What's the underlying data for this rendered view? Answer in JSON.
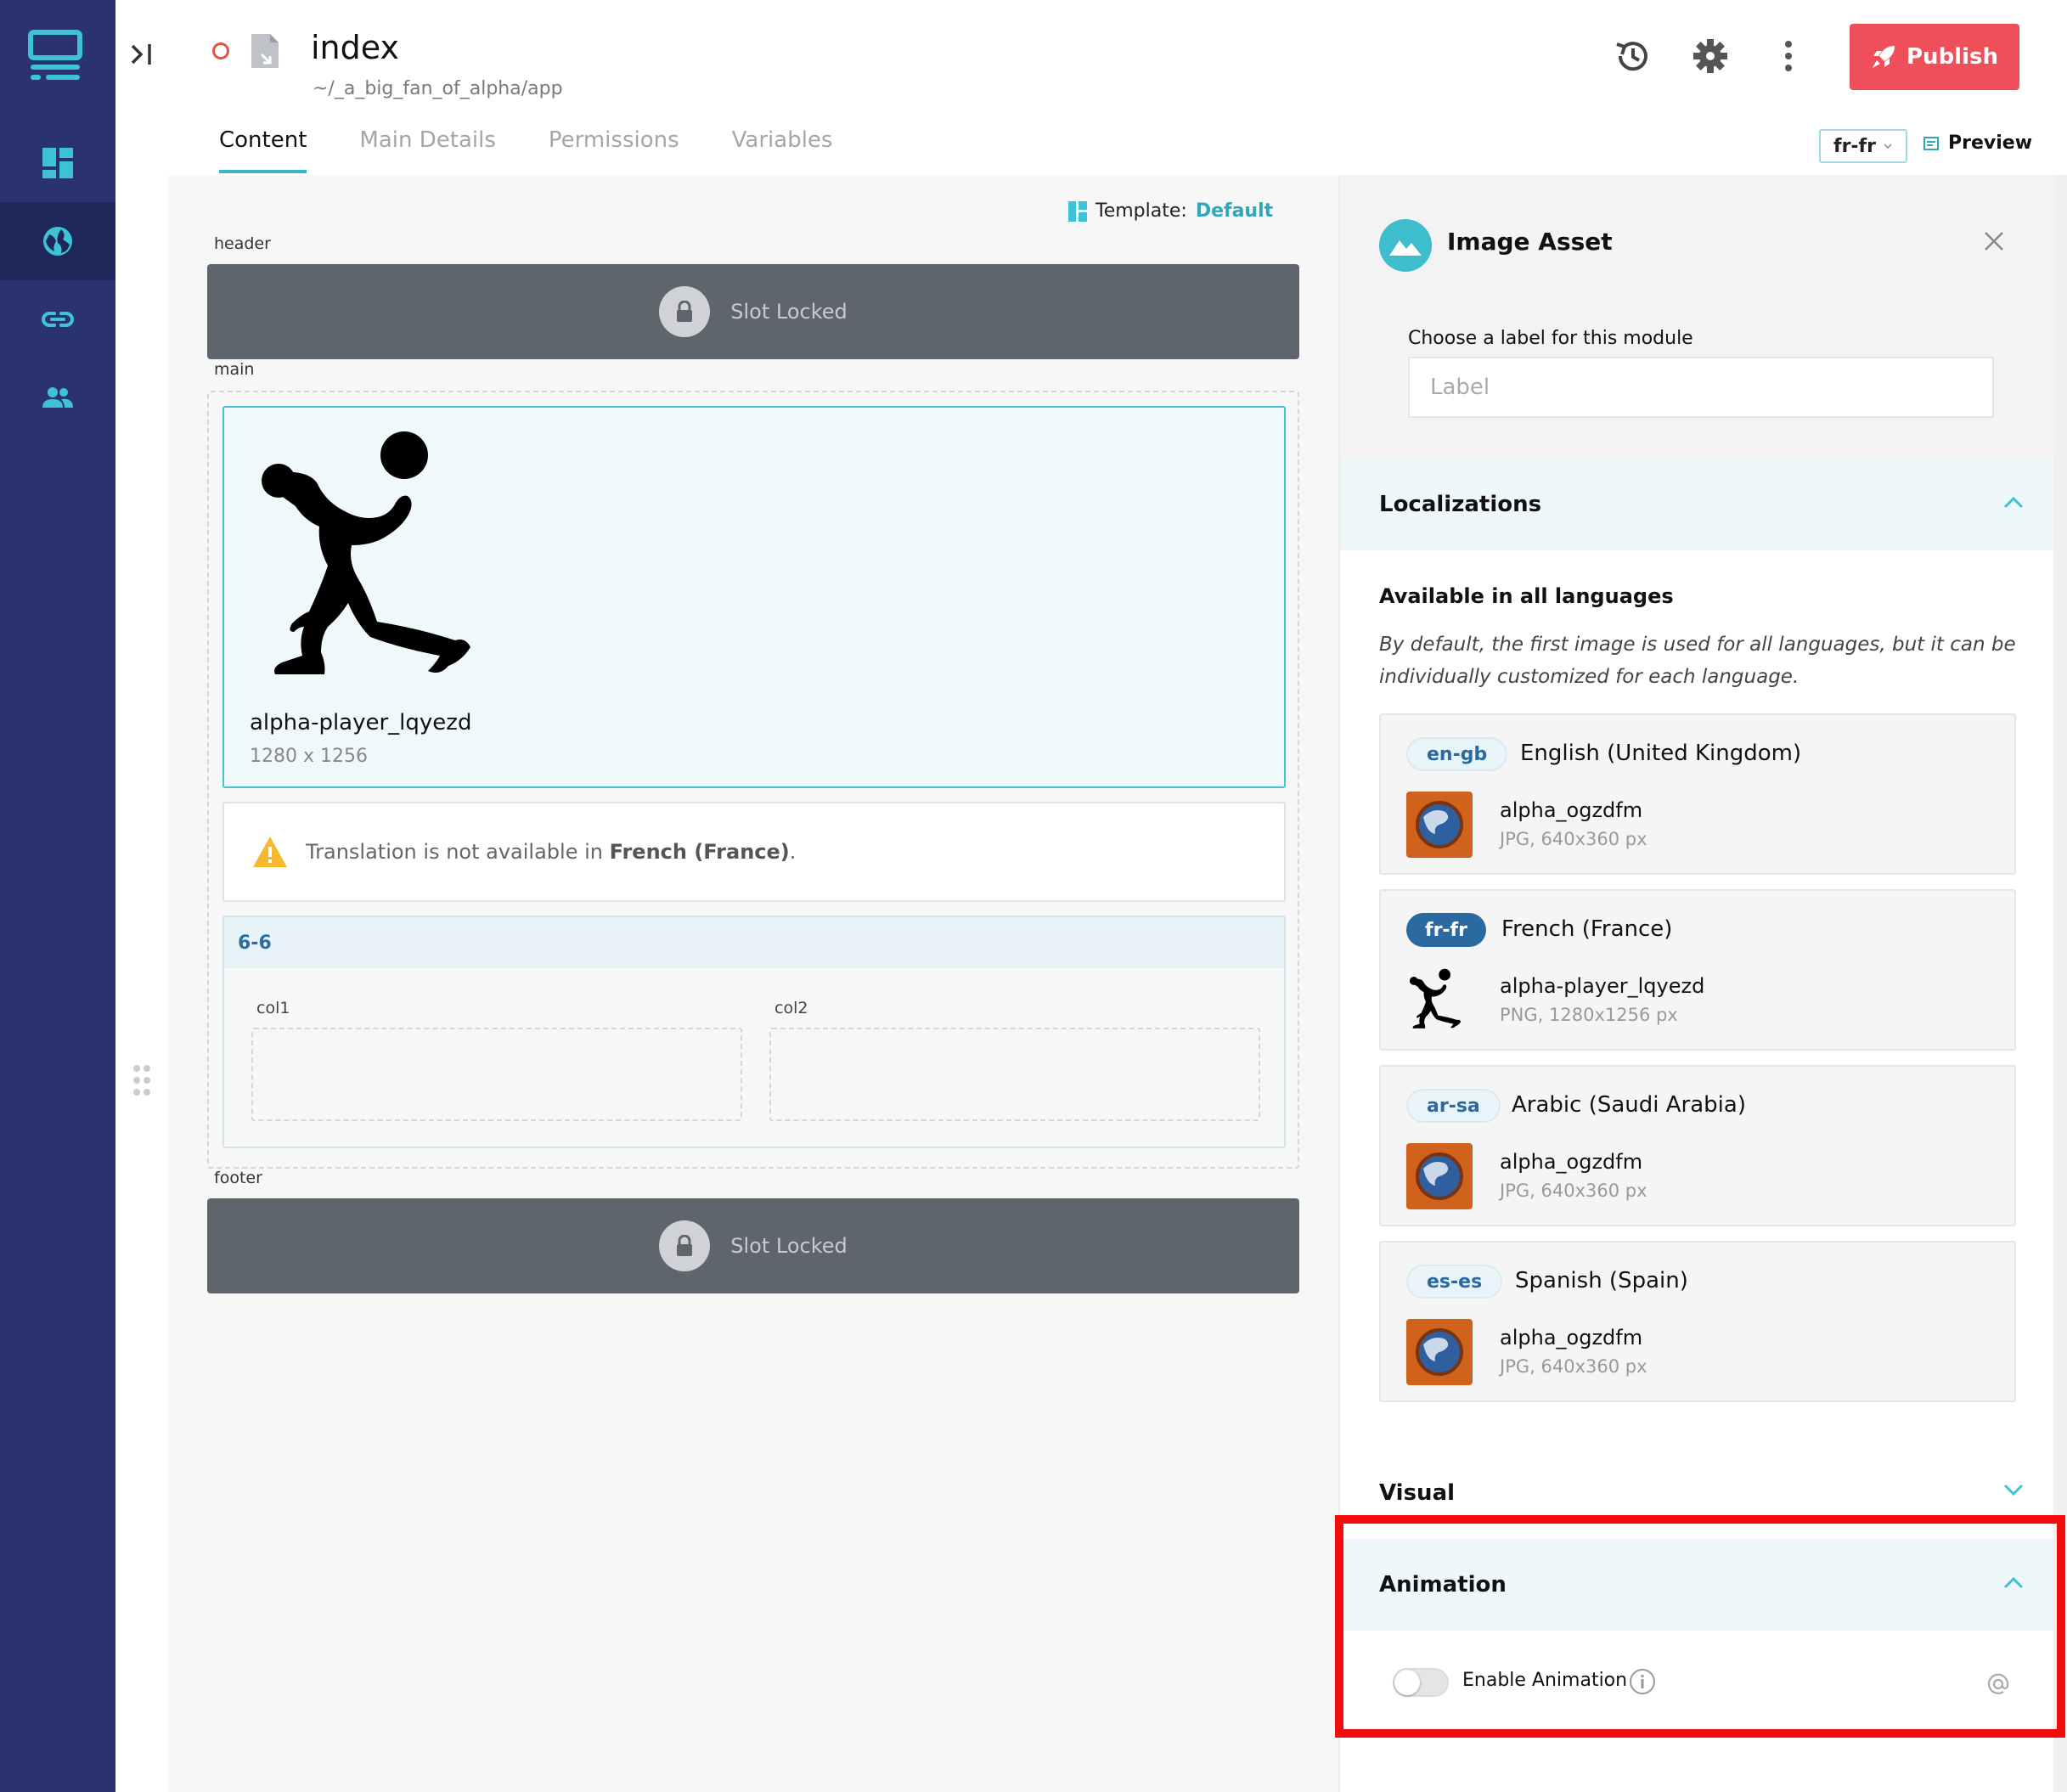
{
  "topbar": {
    "page_name": "index",
    "page_path": "~/_a_big_fan_of_alpha/app",
    "tabs": [
      {
        "label": "Content",
        "active": true
      },
      {
        "label": "Main Details",
        "active": false
      },
      {
        "label": "Permissions",
        "active": false
      },
      {
        "label": "Variables",
        "active": false
      }
    ],
    "publish_label": "Publish",
    "locale": "fr-fr",
    "preview_label": "Preview",
    "icons": [
      "history-icon",
      "gear-icon",
      "more-vertical-icon"
    ]
  },
  "canvas": {
    "template_label": "Template:",
    "template_value": "Default",
    "slots": {
      "header_caption": "header",
      "main_caption": "main",
      "footer_caption": "footer",
      "locked_text": "Slot Locked"
    },
    "image_module": {
      "name": "alpha-player_lqyezd",
      "dimensions": "1280 x 1256"
    },
    "warning": {
      "prefix": "Translation is not available in ",
      "language": "French (France)",
      "suffix": "."
    },
    "grid": {
      "title": "6-6",
      "col1": "col1",
      "col2": "col2"
    }
  },
  "panel": {
    "title": "Image Asset",
    "label_caption": "Choose a label for this module",
    "label_placeholder": "Label",
    "localizations_title": "Localizations",
    "available_title": "Available in all languages",
    "available_desc": "By default, the first image is used for all languages, but it can be individually customized for each language.",
    "locales": [
      {
        "code": "en-gb",
        "name": "English (United Kingdom)",
        "file": "alpha_ogzdfm",
        "meta": "JPG, 640x360 px",
        "current": false
      },
      {
        "code": "fr-fr",
        "name": "French (France)",
        "file": "alpha-player_lqyezd",
        "meta": "PNG, 1280x1256 px",
        "current": true
      },
      {
        "code": "ar-sa",
        "name": "Arabic (Saudi Arabia)",
        "file": "alpha_ogzdfm",
        "meta": "JPG, 640x360 px",
        "current": false
      },
      {
        "code": "es-es",
        "name": "Spanish (Spain)",
        "file": "alpha_ogzdfm",
        "meta": "JPG, 640x360 px",
        "current": false
      }
    ],
    "visual_title": "Visual",
    "animation_title": "Animation",
    "enable_animation_label": "Enable Animation",
    "enable_animation_on": false
  },
  "colors": {
    "sidebar": "#2b3270",
    "accent": "#37b7c9",
    "publish": "#ef4f58",
    "highlight": "#f20d0d"
  }
}
